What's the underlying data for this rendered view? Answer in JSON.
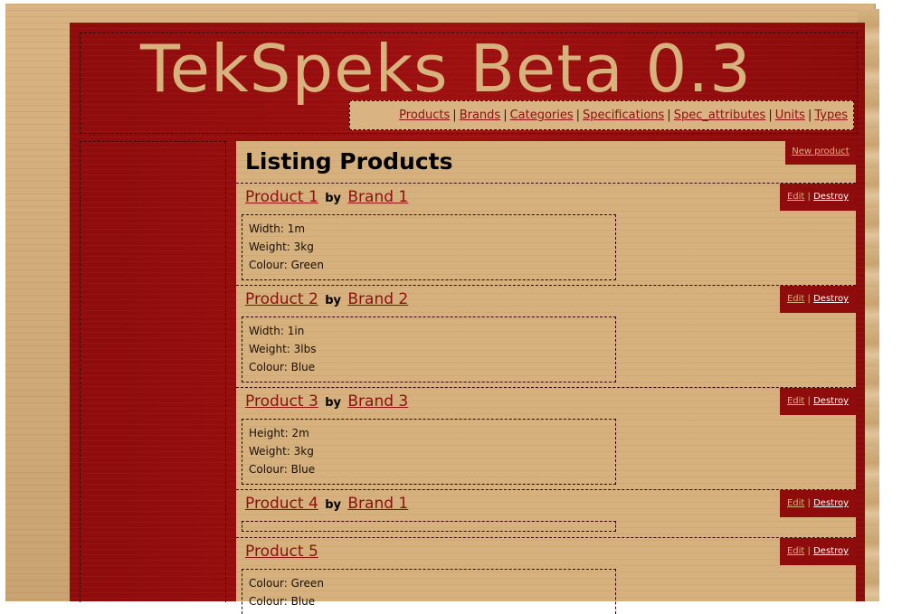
{
  "header": {
    "title": "TekSpeks Beta 0.3"
  },
  "nav": {
    "items": [
      {
        "label": "Products"
      },
      {
        "label": "Brands"
      },
      {
        "label": "Categories"
      },
      {
        "label": "Specifications"
      },
      {
        "label": "Spec_attributes"
      },
      {
        "label": "Units"
      },
      {
        "label": "Types"
      }
    ],
    "separator": "|"
  },
  "main": {
    "title": "Listing Products",
    "new_product_label": "New product",
    "by_label": "by",
    "edit_label": "Edit",
    "destroy_label": "Destroy",
    "action_separator": "|",
    "products": [
      {
        "name": "Product 1",
        "brand": "Brand 1",
        "specs": [
          "Width: 1m",
          "Weight: 3kg",
          "Colour: Green"
        ]
      },
      {
        "name": "Product 2",
        "brand": "Brand 2",
        "specs": [
          "Width: 1in",
          "Weight: 3lbs",
          "Colour: Blue"
        ]
      },
      {
        "name": "Product 3",
        "brand": "Brand 3",
        "specs": [
          "Height: 2m",
          "Weight: 3kg",
          "Colour: Blue"
        ]
      },
      {
        "name": "Product 4",
        "brand": "Brand 1",
        "specs": []
      },
      {
        "name": "Product 5",
        "brand": "",
        "specs": [
          "Colour: Green",
          "Colour: Blue"
        ]
      }
    ]
  },
  "colors": {
    "frame_red": "#8e0c0c",
    "cardboard": "#d6b17e",
    "title_tan": "#d8b27c",
    "link_red": "#8b1010"
  }
}
